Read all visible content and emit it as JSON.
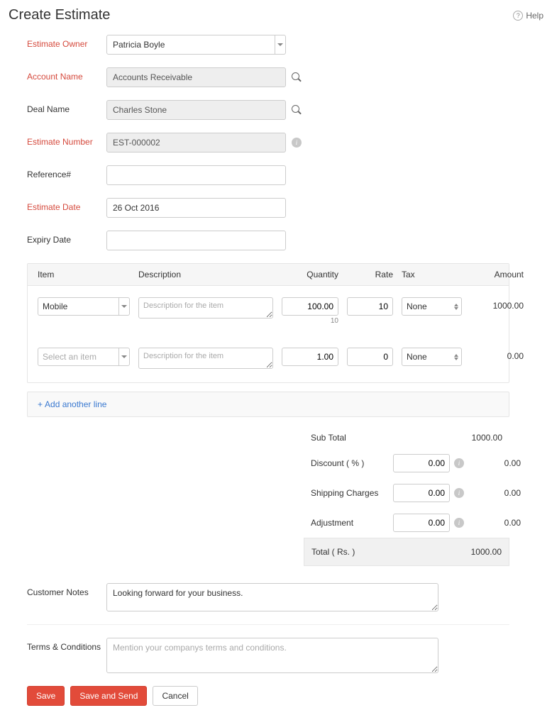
{
  "header": {
    "title": "Create Estimate",
    "help_label": "Help"
  },
  "fields": {
    "estimate_owner": {
      "label": "Estimate Owner",
      "value": "Patricia Boyle"
    },
    "account_name": {
      "label": "Account Name",
      "value": "Accounts Receivable"
    },
    "deal_name": {
      "label": "Deal Name",
      "value": "Charles Stone"
    },
    "estimate_number": {
      "label": "Estimate Number",
      "value": "EST-000002"
    },
    "reference": {
      "label": "Reference#",
      "value": ""
    },
    "estimate_date": {
      "label": "Estimate Date",
      "value": "26 Oct 2016"
    },
    "expiry_date": {
      "label": "Expiry Date",
      "value": ""
    }
  },
  "items": {
    "columns": {
      "item": "Item",
      "description": "Description",
      "quantity": "Quantity",
      "rate": "Rate",
      "tax": "Tax",
      "amount": "Amount"
    },
    "desc_placeholder": "Description for the item",
    "item_placeholder": "Select an item",
    "tax_none": "None",
    "rows": [
      {
        "item": "Mobile",
        "description": "",
        "quantity": "100.00",
        "qty_sub": "10",
        "rate": "10",
        "tax": "None",
        "amount": "1000.00"
      },
      {
        "item": "",
        "description": "",
        "quantity": "1.00",
        "qty_sub": "",
        "rate": "0",
        "tax": "None",
        "amount": "0.00"
      }
    ],
    "add_another": "Add another line"
  },
  "totals": {
    "subtotal": {
      "label": "Sub Total",
      "value": "1000.00"
    },
    "discount": {
      "label": "Discount ( % )",
      "input": "0.00",
      "value": "0.00"
    },
    "shipping": {
      "label": "Shipping Charges",
      "input": "0.00",
      "value": "0.00"
    },
    "adjustment": {
      "label": "Adjustment",
      "input": "0.00",
      "value": "0.00"
    },
    "total": {
      "label": "Total ( Rs. )",
      "value": "1000.00"
    }
  },
  "notes": {
    "customer_notes_label": "Customer Notes",
    "customer_notes_value": "Looking forward for your business.",
    "terms_label": "Terms & Conditions",
    "terms_placeholder": "Mention your companys terms and conditions."
  },
  "buttons": {
    "save": "Save",
    "save_send": "Save and Send",
    "cancel": "Cancel"
  }
}
